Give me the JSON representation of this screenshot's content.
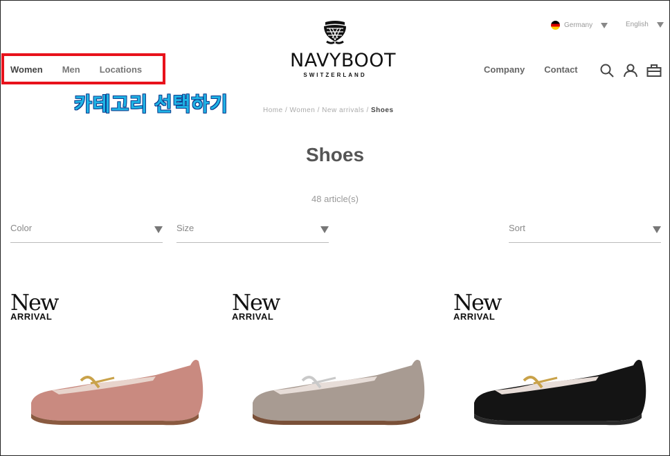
{
  "nav": {
    "women": "Women",
    "men": "Men",
    "locations": "Locations",
    "company": "Company",
    "contact": "Contact"
  },
  "annotation": "카테고리 선택하기",
  "logo": {
    "brand": "NAVYBOOT",
    "sub": "SWITZERLAND"
  },
  "locale": {
    "country": "Germany",
    "language": "English"
  },
  "icons": [
    "search-icon",
    "user-icon",
    "cart-icon",
    "crest-logo-icon",
    "germany-flag-icon"
  ],
  "breadcrumb": [
    "Home",
    "Women",
    "New arrivals",
    "Shoes"
  ],
  "page": {
    "title": "Shoes",
    "count": "48 article(s)"
  },
  "filters": {
    "color": "Color",
    "size": "Size",
    "sort": "Sort"
  },
  "products": [
    {
      "badge_top": "New",
      "badge_bottom": "ARRIVAL",
      "color": "#c98a80"
    },
    {
      "badge_top": "New",
      "badge_bottom": "ARRIVAL",
      "color": "#a89b92"
    },
    {
      "badge_top": "New",
      "badge_bottom": "ARRIVAL",
      "color": "#141414"
    }
  ],
  "colors": {
    "highlight": "#e8121b",
    "annotation": "#1fb4e6"
  }
}
